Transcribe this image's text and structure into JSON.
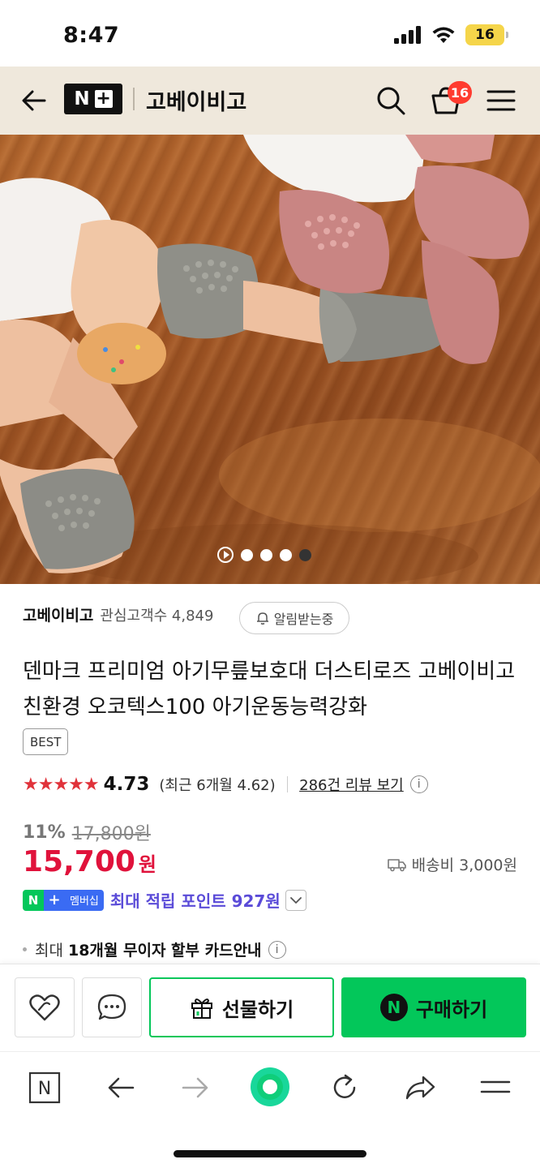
{
  "status_bar": {
    "time": "8:47",
    "battery": "16"
  },
  "header": {
    "store_title": "고베이비고",
    "logo_letter": "N",
    "logo_plus": "+",
    "cart_count": "16"
  },
  "gallery": {
    "slide_count": 4,
    "active_slide": 4
  },
  "store": {
    "name": "고베이비고",
    "fans": "관심고객수 4,849",
    "alarm_label": "알림받는중"
  },
  "product": {
    "title": "덴마크 프리미엄 아기무릎보호대 더스티로즈 고베이비고 친환경 오코텍스100 아기운동능력강화",
    "badge": "BEST",
    "stars": "★★★★★",
    "rating": "4.73",
    "rating_recent": "(최근 6개월 4.62)",
    "reviews_link": "286건 리뷰 보기",
    "discount_rate": "11%",
    "original_price": "17,800원",
    "price": "15,700",
    "price_unit": "원",
    "shipping": "배송비 3,000원",
    "member_n": "N",
    "member_plus": "+",
    "member_label": "멤버십",
    "points": "최대 적립 포인트 927원",
    "installment_prefix": "최대",
    "installment_bold": "18개월 무이자 할부 카드안내"
  },
  "actions": {
    "gift_label": "선물하기",
    "buy_label": "구매하기",
    "buy_icon_letter": "N"
  },
  "browser_nav": {
    "home_letter": "N"
  },
  "colors": {
    "accent_green": "#03c75a",
    "price_red": "#e0123b",
    "header_bg": "#efe8dc",
    "point_purple": "#5a4bd8"
  }
}
